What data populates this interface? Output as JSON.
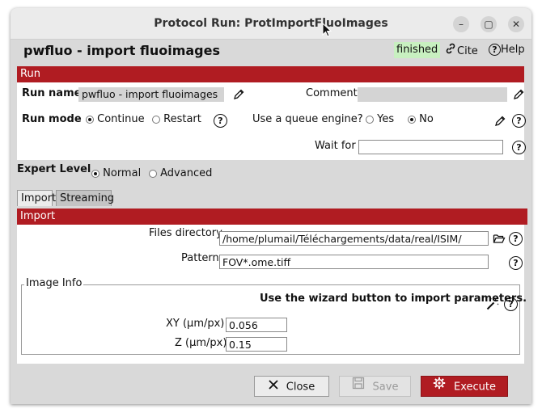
{
  "window": {
    "title": "Protocol Run: ProtImportFluoImages",
    "minimize": "–",
    "maximize": "▢",
    "close": "✕"
  },
  "header": {
    "protocol_name": "pwfluo - import fluoimages",
    "status": "finished",
    "status_color": "#c8f0c0",
    "cite_label": "Cite",
    "help_label": "Help"
  },
  "run_section": {
    "title": "Run",
    "run_name_label": "Run name",
    "run_name_value": "pwfluo - import fluoimages",
    "comment_label": "Comment",
    "comment_value": "",
    "run_mode_label": "Run mode",
    "run_mode_options": [
      "Continue",
      "Restart"
    ],
    "run_mode_selected": "Continue",
    "queue_label": "Use a queue engine?",
    "queue_options": [
      "Yes",
      "No"
    ],
    "queue_selected": "No",
    "wait_for_label": "Wait for",
    "wait_for_value": ""
  },
  "expert": {
    "label": "Expert Level",
    "options": [
      "Normal",
      "Advanced"
    ],
    "selected": "Normal"
  },
  "tabs": [
    {
      "label": "Import",
      "active": true
    },
    {
      "label": "Streaming",
      "active": false
    }
  ],
  "import_section": {
    "title": "Import",
    "files_dir_label": "Files directory",
    "files_dir_value": "/home/plumail/Téléchargements/data/real/ISIM/",
    "pattern_label": "Pattern",
    "pattern_value": "FOV*.ome.tiff",
    "image_info": {
      "legend": "Image Info",
      "wizard_text": "Use the wizard button to import parameters.",
      "xy_label": "XY (μm/px)",
      "xy_value": "0.056",
      "z_label": "Z (μm/px)",
      "z_value": "0.15"
    }
  },
  "footer": {
    "close_label": "Close",
    "save_label": "Save",
    "execute_label": "Execute",
    "execute_color": "#b01c22"
  },
  "help_glyph": "?"
}
